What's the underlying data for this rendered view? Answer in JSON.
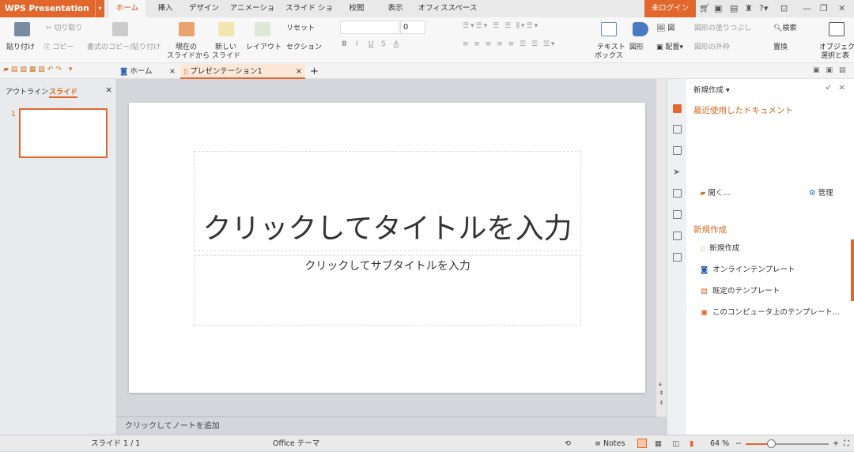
{
  "app": {
    "name": "WPS Presentation",
    "login": "未ログイン",
    "accent": "#e2672d"
  },
  "menu_tabs": [
    "ホーム",
    "挿入",
    "デザイン",
    "アニメーション",
    "スライド ショー",
    "校閲",
    "表示",
    "オフィススペース"
  ],
  "ribbon": {
    "paste": "貼り付け",
    "cut": "切り取り",
    "copy": "コピー",
    "format_painter": "書式のコピー/貼り付け",
    "from_current": [
      "現在の",
      "スライドから"
    ],
    "new_slide": [
      "新しい",
      "スライド"
    ],
    "layout": "レイアウト",
    "reset": "リセット",
    "section": "セクション",
    "font_size": "0",
    "bold": "B",
    "italic": "I",
    "underline": "U",
    "strike": "S",
    "font_color": "A",
    "textbox": [
      "テキスト",
      "ボックス"
    ],
    "shape": "図形",
    "picture": "図",
    "arrange": "配置",
    "fill": "図形の塗りつぶし",
    "outline": "図形の外枠",
    "find": "検索",
    "replace": "置換",
    "select": [
      "オブジェク",
      "選択と表"
    ]
  },
  "doc_tabs": [
    {
      "label": "ホーム"
    },
    {
      "label": "プレゼンテーション1"
    }
  ],
  "left_panel": {
    "tab_outline": "アウトライン",
    "tab_slides": "スライド",
    "slide_number": "1"
  },
  "slide": {
    "title": "クリックしてタイトルを入力",
    "subtitle": "クリックしてサブタイトルを入力"
  },
  "notes_placeholder": "クリックしてノートを追加",
  "task_pane": {
    "header": "新規作成",
    "recent": "最近使用したドキュメント",
    "open": "開く...",
    "manage": "管理",
    "new_section": "新規作成",
    "items": [
      "新規作成",
      "オンラインテンプレート",
      "既定のテンプレート",
      "このコンピュータ上のテンプレート..."
    ]
  },
  "status": {
    "slide": "スライド 1 / 1",
    "theme": "Office テーマ",
    "notes": "Notes",
    "zoom": "64 %",
    "zoom_level": 64
  }
}
